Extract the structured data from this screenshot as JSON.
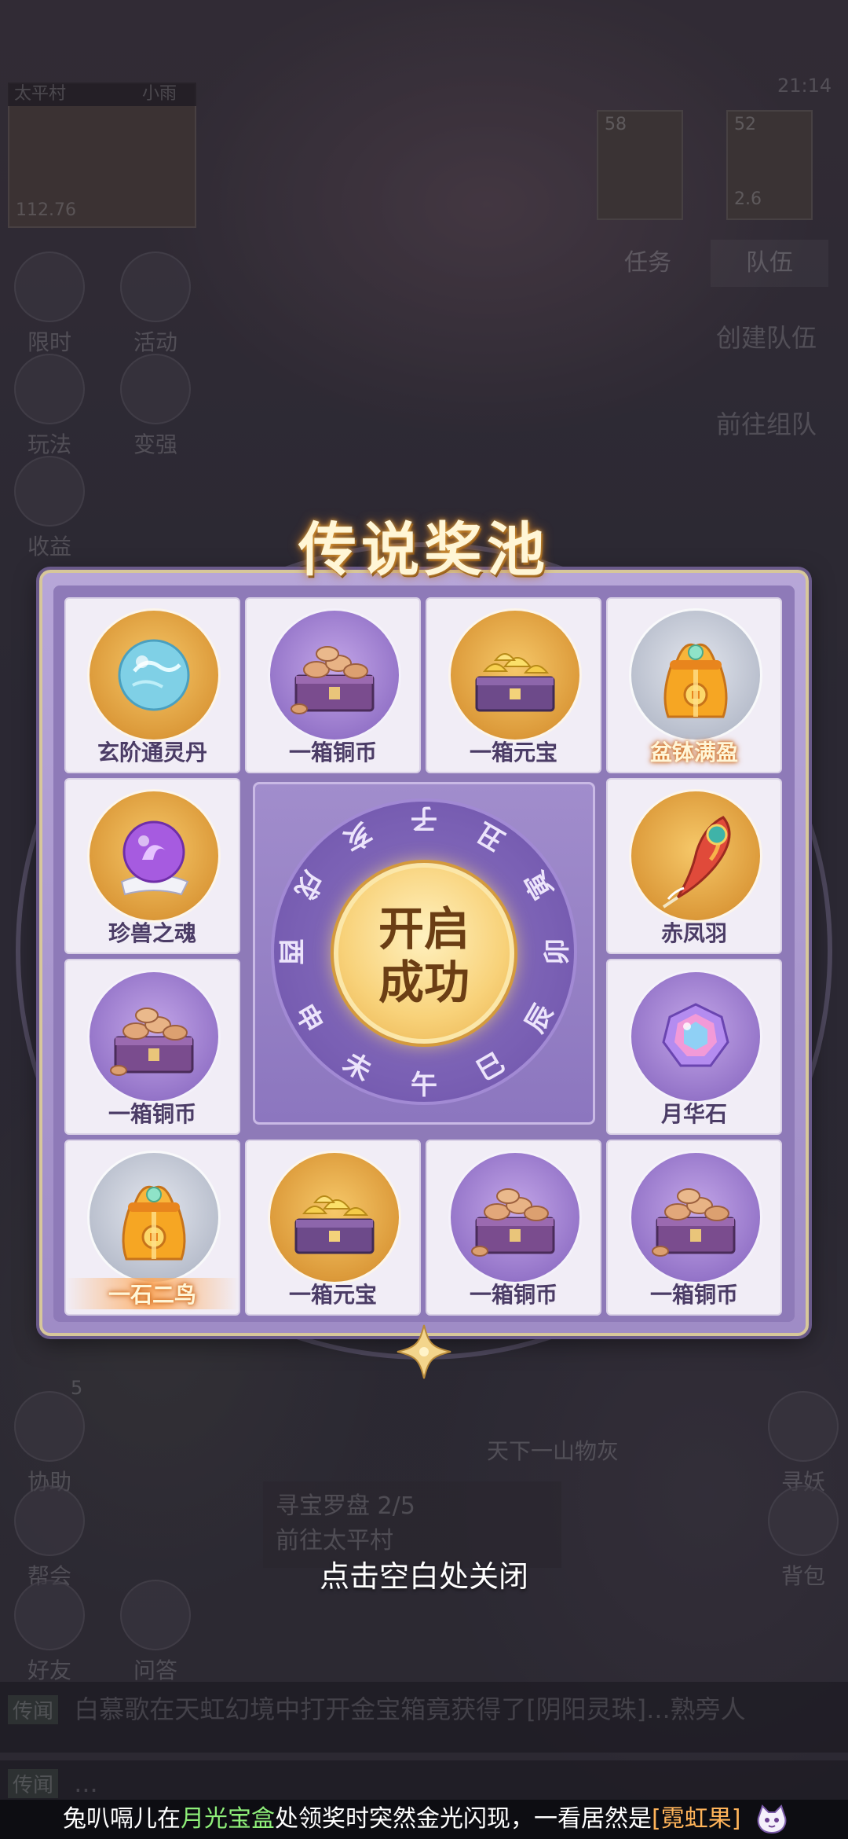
{
  "background": {
    "location": "太平村",
    "zone": "小雨",
    "clock": "21:14",
    "coords": "112.76",
    "party": [
      {
        "level": "58"
      },
      {
        "level": "52",
        "sub": "2.6"
      }
    ],
    "tabs": [
      "任务",
      "队伍"
    ],
    "team_actions": [
      "创建队伍",
      "前往组队"
    ],
    "side_left": [
      "限时",
      "活动",
      "玩法",
      "变强",
      "收益"
    ],
    "side_bottom_left": [
      "协助",
      "帮会",
      "好友",
      "问答"
    ],
    "side_bottom_right": [
      "寻妖",
      "背包"
    ],
    "assist_badge": "5",
    "quest": {
      "title": "寻宝罗盘 2/5",
      "subtitle": "前往太平村"
    },
    "npc_name": "天下一山物灰",
    "chat": [
      {
        "tag": "传闻",
        "text": "白慕歌在天虹幻境中打开金宝箱竟获得了[阴阳灵珠]...熟旁人"
      },
      {
        "tag": "传闻",
        "text": "..."
      }
    ]
  },
  "popup": {
    "title": "传说奖池",
    "open_button_line1": "开启",
    "open_button_line2": "成功",
    "branches": [
      "子",
      "丑",
      "寅",
      "卯",
      "辰",
      "巳",
      "午",
      "未",
      "申",
      "酉",
      "戌",
      "亥"
    ],
    "items": [
      {
        "name": "玄阶通灵丹",
        "icon": "blue-orb-icon",
        "disc": "gold",
        "special": false
      },
      {
        "name": "一箱铜币",
        "icon": "copper-coin-chest-icon",
        "disc": "purple",
        "special": false
      },
      {
        "name": "一箱元宝",
        "icon": "gold-ingot-chest-icon",
        "disc": "gold",
        "special": false
      },
      {
        "name": "盆钵满盈",
        "icon": "lucky-bag-icon",
        "disc": "silver",
        "special": true
      },
      {
        "name": "珍兽之魂",
        "icon": "purple-crystal-ball-icon",
        "disc": "gold",
        "special": false
      },
      {
        "name": "赤凤羽",
        "icon": "phoenix-feather-icon",
        "disc": "gold",
        "special": false
      },
      {
        "name": "一箱铜币",
        "icon": "copper-coin-chest-icon",
        "disc": "purple",
        "special": false
      },
      {
        "name": "月华石",
        "icon": "moon-gem-icon",
        "disc": "purple",
        "special": false
      },
      {
        "name": "一石二鸟",
        "icon": "lucky-bag-icon",
        "disc": "silver",
        "special": true
      },
      {
        "name": "一箱元宝",
        "icon": "gold-ingot-chest-icon",
        "disc": "gold",
        "special": false
      },
      {
        "name": "一箱铜币",
        "icon": "copper-coin-chest-icon",
        "disc": "purple",
        "special": false
      },
      {
        "name": "一箱铜币",
        "icon": "copper-coin-chest-icon",
        "disc": "purple",
        "special": false
      }
    ],
    "close_hint": "点击空白处关闭"
  },
  "marquee": {
    "player": "兔叭嗝儿",
    "t1": "在",
    "place": "月光宝盒",
    "t2": "处领奖时突然金光闪现，一看居然是",
    "reward": "[霓虹果]"
  },
  "colors": {
    "accent_purple": "#8e7ab8",
    "gold": "#f8d27a",
    "special_text_glow": "#d7731e",
    "marquee_green": "#8ff07a",
    "marquee_orange": "#ffb45a"
  }
}
